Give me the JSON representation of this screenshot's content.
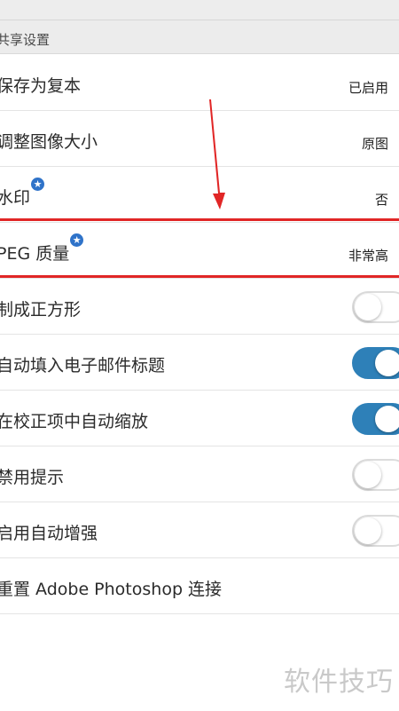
{
  "section": {
    "header": "共享设置"
  },
  "rows": {
    "save_copy": {
      "label": "保存为复本",
      "value": "已启用"
    },
    "resize": {
      "label": "调整图像大小",
      "value": "原图"
    },
    "watermark": {
      "label": "水印",
      "value": "否"
    },
    "jpeg_quality": {
      "label": "PEG 质量",
      "value": "非常高"
    },
    "crop_square": {
      "label": "制成正方形",
      "toggle": "off"
    },
    "auto_email_subject": {
      "label": "自动填入电子邮件标题",
      "toggle": "on"
    },
    "auto_zoom_correction": {
      "label": "在校正项中自动缩放",
      "toggle": "on"
    },
    "disable_tips": {
      "label": "禁用提示",
      "toggle": "off"
    },
    "auto_enhance": {
      "label": "启用自动增强",
      "toggle": "off"
    },
    "reset_photoshop": {
      "label": "重置 Adobe Photoshop 连接"
    }
  },
  "icons": {
    "premium_badge": "star-badge-icon",
    "annotation": "red-arrow-icon"
  },
  "colors": {
    "accent": "#2e80b8",
    "highlight": "#e12626",
    "badge": "#2f73c9"
  },
  "watermark_text": "软件技巧"
}
